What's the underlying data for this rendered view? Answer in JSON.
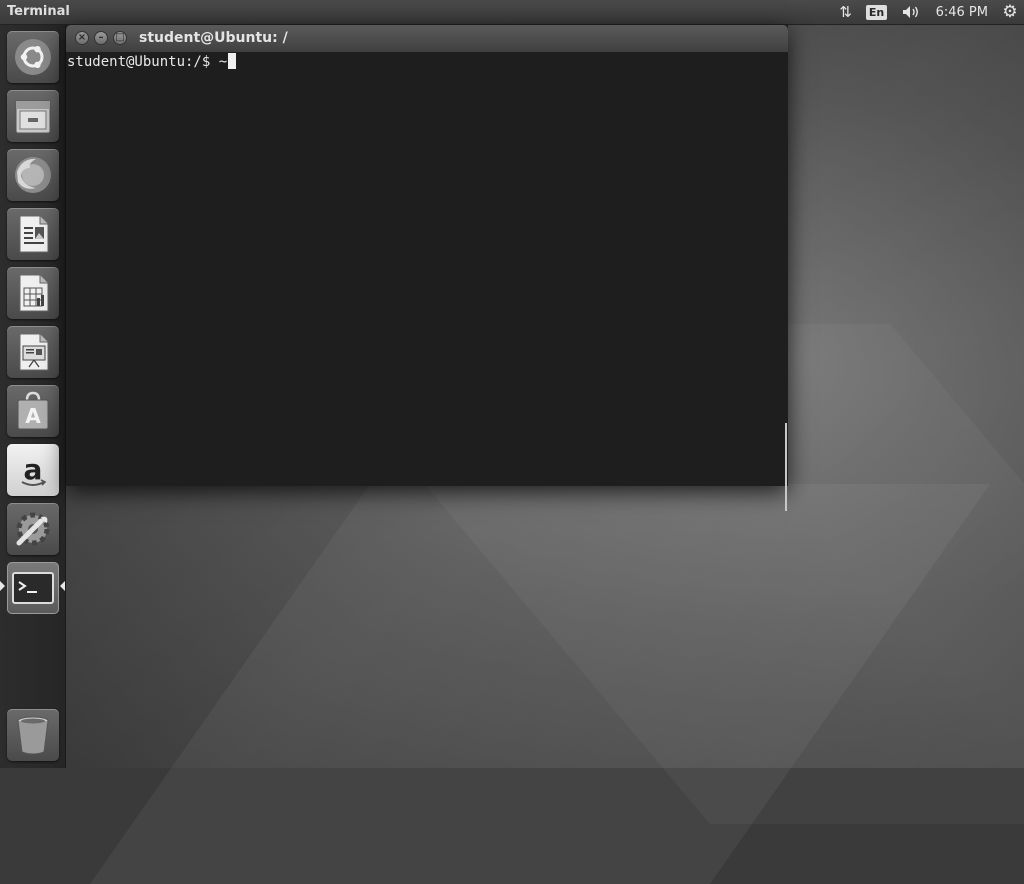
{
  "panel": {
    "app_title": "Terminal",
    "network_icon": "network-updown-icon",
    "keyboard_layout": "En",
    "volume_icon": "volume-icon",
    "clock": "6:46 PM",
    "session_icon": "gear-icon"
  },
  "launcher": {
    "items": [
      {
        "name": "Dash",
        "icon": "ubuntu-logo-icon"
      },
      {
        "name": "Files",
        "icon": "file-cabinet-icon"
      },
      {
        "name": "Firefox Web Browser",
        "icon": "firefox-icon"
      },
      {
        "name": "LibreOffice Writer",
        "icon": "writer-document-icon"
      },
      {
        "name": "LibreOffice Calc",
        "icon": "calc-spreadsheet-icon"
      },
      {
        "name": "LibreOffice Impress",
        "icon": "impress-presentation-icon"
      },
      {
        "name": "Ubuntu Software",
        "icon": "software-center-icon"
      },
      {
        "name": "Amazon",
        "icon": "amazon-icon"
      },
      {
        "name": "System Settings",
        "icon": "settings-icon"
      },
      {
        "name": "Terminal",
        "icon": "terminal-icon",
        "active": true
      },
      {
        "name": "Trash",
        "icon": "trash-icon"
      }
    ]
  },
  "window": {
    "title": "student@Ubuntu: /",
    "prompt": "student@Ubuntu:/$ ~"
  }
}
